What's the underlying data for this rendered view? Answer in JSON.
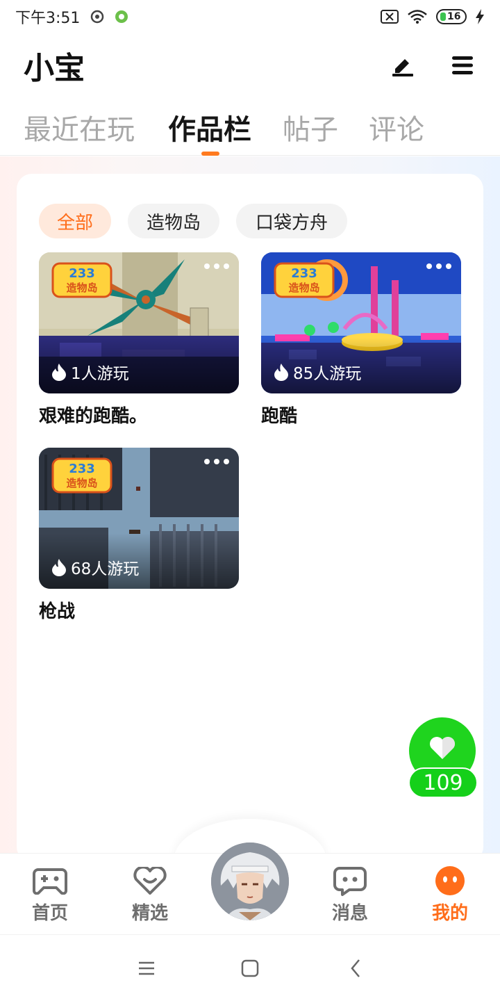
{
  "status_bar": {
    "time": "下午3:51",
    "battery": "16"
  },
  "header": {
    "title": "小宝"
  },
  "tabs": [
    {
      "label": "最近在玩"
    },
    {
      "label": "作品栏"
    },
    {
      "label": "帖子"
    },
    {
      "label": "评论"
    }
  ],
  "filters": [
    {
      "label": "全部"
    },
    {
      "label": "造物岛"
    },
    {
      "label": "口袋方舟"
    }
  ],
  "games": [
    {
      "title": "艰难的跑酷。",
      "plays": "1人游玩"
    },
    {
      "title": "跑酷",
      "plays": "85人游玩"
    },
    {
      "title": "枪战",
      "plays": "68人游玩"
    }
  ],
  "like": {
    "count": "109"
  },
  "bottom_nav": [
    {
      "label": "首页",
      "icon": "gamepad-icon"
    },
    {
      "label": "精选",
      "icon": "heart-smile-icon"
    },
    {
      "label": "消息",
      "icon": "chat-icon"
    },
    {
      "label": "我的",
      "icon": "profile-icon"
    }
  ],
  "colors": {
    "accent": "#ff6d1a",
    "like_green": "#1fd41e",
    "active_chip_bg": "#ffe9dc"
  }
}
